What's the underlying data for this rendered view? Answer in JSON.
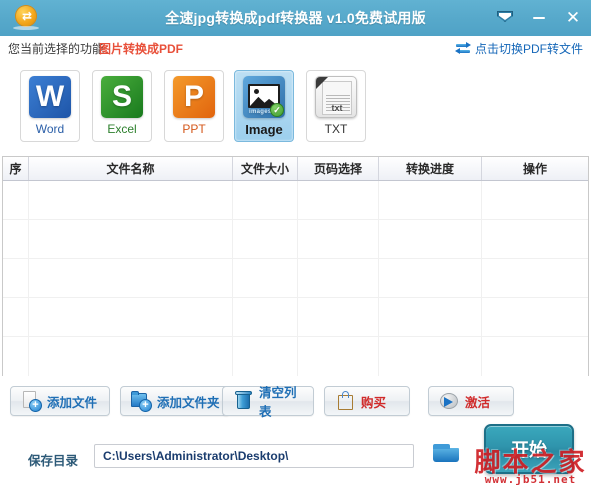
{
  "window": {
    "title": "全速jpg转换成pdf转换器 v1.0免费试用版",
    "logo_icon": "app-logo-icon",
    "skin_icon": "skin-shield-icon",
    "minimize_icon": "minimize-icon",
    "close_icon": "close-icon",
    "titlebar_color": "#57a9cb"
  },
  "funcbar": {
    "label": "您当前选择的功能：",
    "value": "图片转换成PDF",
    "value_color": "#e8503a",
    "switch_link": "点击切换PDF转文件",
    "switch_icon": "swap-arrows-icon",
    "link_color": "#1567b8"
  },
  "formats": {
    "items": [
      {
        "key": "word",
        "label": "Word",
        "glyph": "W",
        "icon": "word-tile-icon",
        "selected": false
      },
      {
        "key": "excel",
        "label": "Excel",
        "glyph": "S",
        "icon": "excel-tile-icon",
        "selected": false
      },
      {
        "key": "ppt",
        "label": "PPT",
        "glyph": "P",
        "icon": "ppt-tile-icon",
        "selected": false
      },
      {
        "key": "image",
        "label": "Image",
        "glyph": "",
        "icon": "image-tile-icon",
        "selected": true,
        "caption": "images",
        "check_icon": "check-badge-icon"
      },
      {
        "key": "txt",
        "label": "TXT",
        "glyph": "",
        "icon": "txt-tile-icon",
        "selected": false,
        "doc_text": "txt"
      }
    ]
  },
  "table": {
    "columns": [
      "序",
      "文件名称",
      "文件大小",
      "页码选择",
      "转换进度",
      "操作"
    ],
    "rows": [],
    "empty_row_count": 5
  },
  "actions": [
    {
      "key": "add-file",
      "label": "添加文件",
      "icon": "add-file-icon",
      "color": "#1f6fb5"
    },
    {
      "key": "add-folder",
      "label": "添加文件夹",
      "icon": "add-folder-icon",
      "color": "#1f6fb5"
    },
    {
      "key": "clear-list",
      "label": "清空列表",
      "icon": "trash-icon",
      "color": "#1f6fb5"
    },
    {
      "key": "buy",
      "label": "购买",
      "icon": "shopping-bag-icon",
      "color": "#d02a2a"
    },
    {
      "key": "activate",
      "label": "激活",
      "icon": "activate-arrow-icon",
      "color": "#d02a2a"
    }
  ],
  "save": {
    "label": "保存目录",
    "path_value": "C:\\Users\\Administrator\\Desktop\\",
    "path_placeholder": "C:\\Users\\Administrator\\Desktop\\",
    "browse_icon": "folder-browse-icon"
  },
  "start": {
    "label": "开始",
    "color": "#2f94ac"
  },
  "watermark": {
    "text": "脚本之家",
    "url": "www.jb51.net",
    "color": "#cf1f24"
  }
}
